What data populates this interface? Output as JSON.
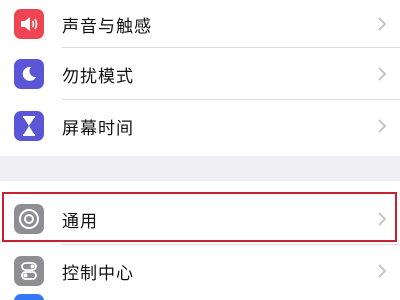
{
  "settings": {
    "group1": [
      {
        "label": "声音与触感",
        "icon": "speaker-icon",
        "color": "#ef4452"
      },
      {
        "label": "勿扰模式",
        "icon": "moon-icon",
        "color": "#5b56d6"
      },
      {
        "label": "屏幕时间",
        "icon": "hourglass-icon",
        "color": "#5b56d6"
      }
    ],
    "group2": [
      {
        "label": "通用",
        "icon": "gear-icon",
        "color": "#8e8e93",
        "highlighted": true
      },
      {
        "label": "控制中心",
        "icon": "switches-icon",
        "color": "#8e8e93"
      }
    ],
    "colors": {
      "highlight_border": "#c8202e",
      "background": "#efeff4",
      "chevron": "#c4c4c9"
    }
  }
}
